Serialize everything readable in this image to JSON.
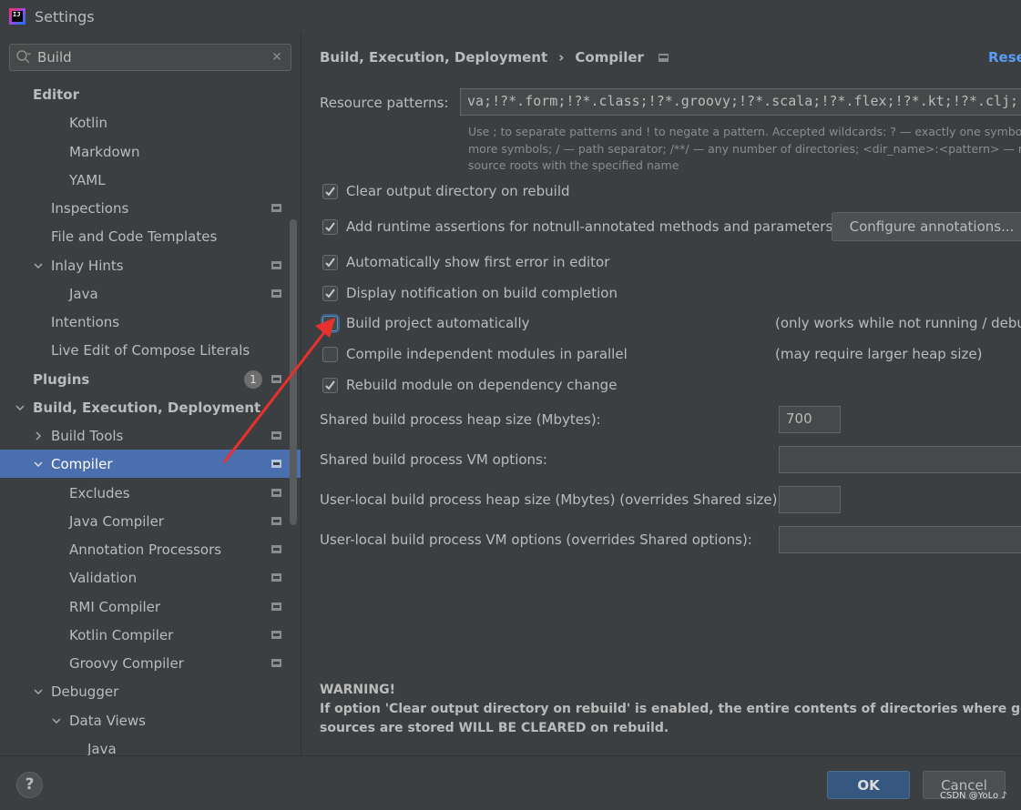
{
  "window": {
    "title": "Settings",
    "app_icon_text": "IJ"
  },
  "search": {
    "value": "Build"
  },
  "tree": {
    "items": [
      {
        "label": "Editor"
      },
      {
        "label": "Kotlin"
      },
      {
        "label": "Markdown"
      },
      {
        "label": "YAML"
      },
      {
        "label": "Inspections"
      },
      {
        "label": "File and Code Templates"
      },
      {
        "label": "Inlay Hints"
      },
      {
        "label": "Java"
      },
      {
        "label": "Intentions"
      },
      {
        "label": "Live Edit of Compose Literals"
      },
      {
        "label": "Plugins",
        "badge": "1"
      },
      {
        "label": "Build, Execution, Deployment"
      },
      {
        "label": "Build Tools"
      },
      {
        "label": "Compiler"
      },
      {
        "label": "Excludes"
      },
      {
        "label": "Java Compiler"
      },
      {
        "label": "Annotation Processors"
      },
      {
        "label": "Validation"
      },
      {
        "label": "RMI Compiler"
      },
      {
        "label": "Kotlin Compiler"
      },
      {
        "label": "Groovy Compiler"
      },
      {
        "label": "Debugger"
      },
      {
        "label": "Data Views"
      },
      {
        "label": "Java"
      }
    ]
  },
  "breadcrumb": {
    "parent": "Build, Execution, Deployment",
    "separator": "›",
    "current": "Compiler"
  },
  "reset_label": "Reset",
  "resource_patterns": {
    "label": "Resource patterns:",
    "value": "va;!?*.form;!?*.class;!?*.groovy;!?*.scala;!?*.flex;!?*.kt;!?*.clj;!?*.aj",
    "hint_lines": [
      "Use ; to separate patterns and ! to negate a pattern. Accepted wildcards: ? — exactly one symbol; * — zero or",
      "more symbols; / — path separator; /**/ — any number of directories;  <dir_name>:<pattern> — restrict to",
      "source roots with the specified name"
    ]
  },
  "options": [
    {
      "label": "Clear output directory on rebuild",
      "checked": true
    },
    {
      "label": "Add runtime assertions for notnull-annotated methods and parameters",
      "checked": true
    },
    {
      "label": "Automatically show first error in editor",
      "checked": true
    },
    {
      "label": "Display notification on build completion",
      "checked": true
    },
    {
      "label": "Build project automatically",
      "checked": true,
      "note": "(only works while not running / debugging)"
    },
    {
      "label": "Compile independent modules in parallel",
      "checked": false,
      "note": "(may require larger heap size)"
    },
    {
      "label": "Rebuild module on dependency change",
      "checked": true
    }
  ],
  "configure_annotations_label": "Configure annotations...",
  "fields": [
    {
      "label": "Shared build process heap size (Mbytes):",
      "value": "700"
    },
    {
      "label": "Shared build process VM options:",
      "value": ""
    },
    {
      "label": "User-local build process heap size (Mbytes) (overrides Shared size):",
      "value": ""
    },
    {
      "label": "User-local build process VM options (overrides Shared options):",
      "value": ""
    }
  ],
  "warning": {
    "title": "WARNING!",
    "line1": "If option 'Clear output directory on rebuild' is enabled, the entire contents of directories where generated",
    "line2": "sources are stored WILL BE CLEARED on rebuild."
  },
  "buttons": {
    "help": "?",
    "ok": "OK",
    "cancel": "Cancel"
  },
  "watermark": "CSDN @YoLo ♪",
  "colors": {
    "selection": "#4b6eaf",
    "link": "#589df6",
    "annotation_arrow": "#e8312f",
    "ok_button": "#365880"
  }
}
